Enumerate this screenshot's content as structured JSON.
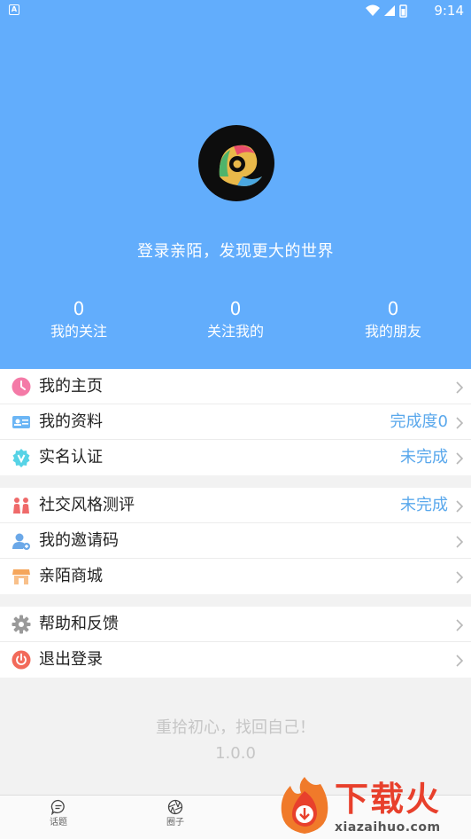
{
  "status_bar": {
    "time": "9:14",
    "left_badge": "A"
  },
  "profile": {
    "login_prompt": "登录亲陌，发现更大的世界"
  },
  "stats": [
    {
      "count": "0",
      "label": "我的关注"
    },
    {
      "count": "0",
      "label": "关注我的"
    },
    {
      "count": "0",
      "label": "我的朋友"
    }
  ],
  "menu": {
    "group1": [
      {
        "label": "我的主页",
        "value": "",
        "icon": "clock-icon",
        "color": "#f47aa7"
      },
      {
        "label": "我的资料",
        "value": "完成度0",
        "icon": "id-card-icon",
        "color": "#6cb6f5"
      },
      {
        "label": "实名认证",
        "value": "未完成",
        "icon": "verified-badge-icon",
        "color": "#56d3e6"
      }
    ],
    "group2": [
      {
        "label": "社交风格测评",
        "value": "未完成",
        "icon": "couple-icon",
        "color": "#ef6a6a"
      },
      {
        "label": "我的邀请码",
        "value": "",
        "icon": "user-invite-icon",
        "color": "#6ba8e8"
      },
      {
        "label": "亲陌商城",
        "value": "",
        "icon": "store-icon",
        "color": "#f5a65b"
      }
    ],
    "group3": [
      {
        "label": "帮助和反馈",
        "value": "",
        "icon": "gear-icon",
        "color": "#9a9a9a"
      },
      {
        "label": "退出登录",
        "value": "",
        "icon": "power-icon",
        "color": "#f26a5a"
      }
    ]
  },
  "footer": {
    "slogan": "重拾初心，找回自己！",
    "version": "1.0.0"
  },
  "tabs": [
    {
      "label": "话题",
      "icon": "chat-bubble-icon"
    },
    {
      "label": "圈子",
      "icon": "aperture-icon"
    }
  ],
  "watermark": {
    "title": "下载火",
    "url": "xiazaihuo.com"
  },
  "colors": {
    "header_bg": "#62adfc",
    "accent_value": "#5aa8ec"
  }
}
